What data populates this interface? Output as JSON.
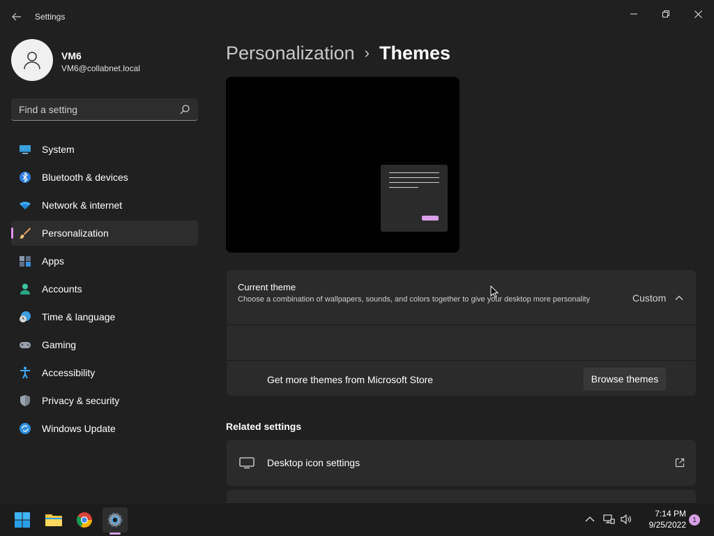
{
  "app": {
    "title": "Settings",
    "window_controls": {
      "minimize": "minimize-icon",
      "maximize": "restore-icon",
      "close": "close-icon"
    }
  },
  "profile": {
    "name": "VM6",
    "email": "VM6@collabnet.local"
  },
  "search": {
    "placeholder": "Find a setting"
  },
  "nav": {
    "items": [
      {
        "label": "System",
        "icon": "system-icon"
      },
      {
        "label": "Bluetooth & devices",
        "icon": "bluetooth-icon"
      },
      {
        "label": "Network & internet",
        "icon": "wifi-icon"
      },
      {
        "label": "Personalization",
        "icon": "brush-icon",
        "active": true
      },
      {
        "label": "Apps",
        "icon": "apps-icon"
      },
      {
        "label": "Accounts",
        "icon": "accounts-icon"
      },
      {
        "label": "Time & language",
        "icon": "clock-globe-icon"
      },
      {
        "label": "Gaming",
        "icon": "gamepad-icon"
      },
      {
        "label": "Accessibility",
        "icon": "accessibility-icon"
      },
      {
        "label": "Privacy & security",
        "icon": "shield-icon"
      },
      {
        "label": "Windows Update",
        "icon": "update-icon"
      }
    ]
  },
  "breadcrumb": {
    "parent": "Personalization",
    "separator": "›",
    "current": "Themes"
  },
  "theme": {
    "title": "Current theme",
    "description": "Choose a combination of wallpapers, sounds, and colors together to give your desktop more personality",
    "value": "Custom",
    "store_text": "Get more themes from Microsoft Store",
    "browse_label": "Browse themes"
  },
  "related": {
    "title": "Related settings",
    "items": [
      {
        "label": "Desktop icon settings",
        "icon": "monitor-icon",
        "action_icon": "open-external-icon"
      }
    ]
  },
  "taskbar": {
    "apps": [
      "windows-start-icon",
      "file-explorer-icon",
      "chrome-icon",
      "settings-gear-icon"
    ],
    "tray": [
      "chevron-up-icon",
      "network-icon",
      "volume-icon"
    ],
    "time": "7:14 PM",
    "date": "9/25/2022",
    "notification_count": "1"
  },
  "colors": {
    "accent": "#e48ff0",
    "background": "#202020",
    "card": "#2b2b2b"
  }
}
